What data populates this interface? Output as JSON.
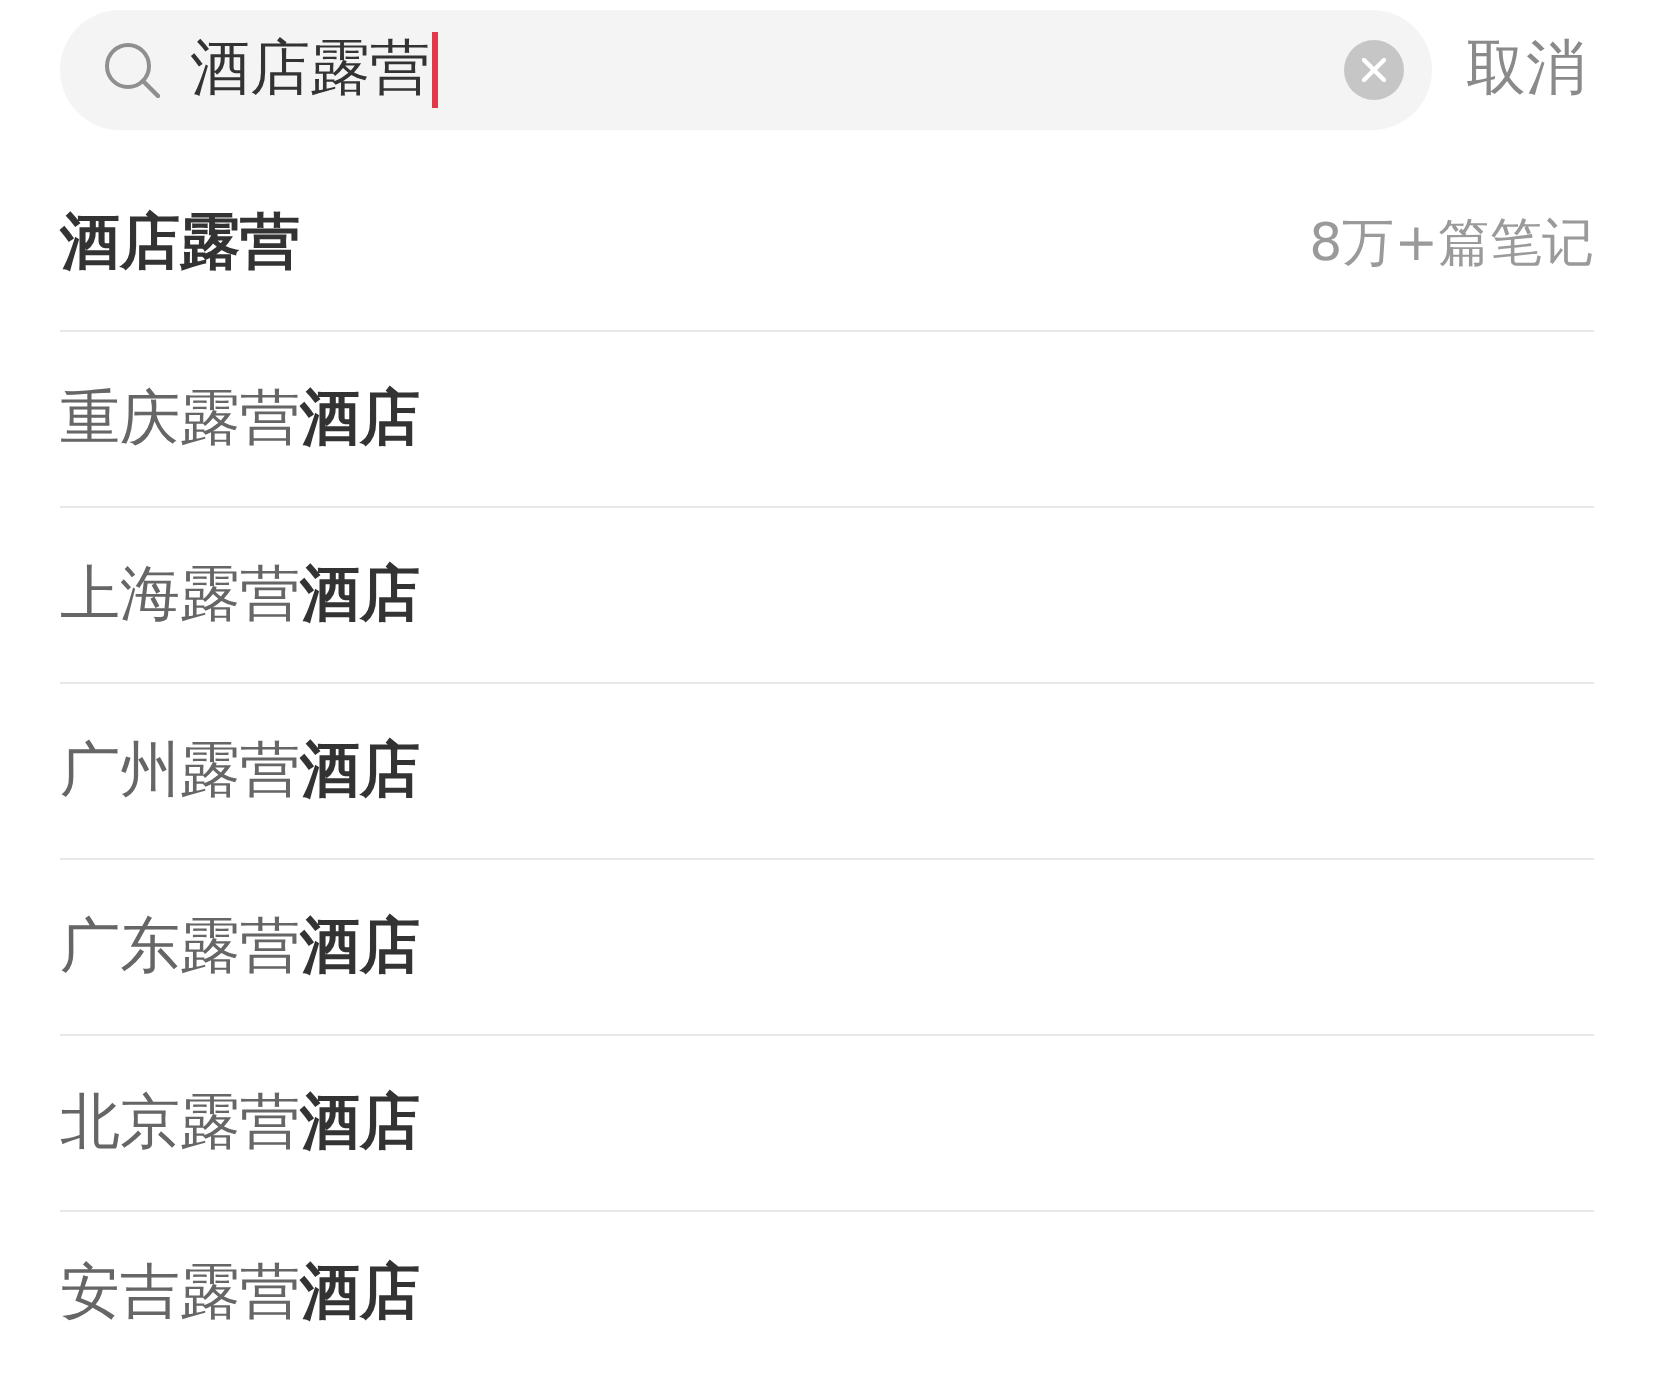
{
  "search": {
    "query": "酒店露营",
    "focused": true,
    "cancel": "取消"
  },
  "suggestions": [
    {
      "kind": "query",
      "text": "酒店露营",
      "note": "8万+篇笔记"
    },
    {
      "kind": "suggestion",
      "text": "重庆露营**酒店**"
    },
    {
      "kind": "suggestion",
      "text": "上海露营**酒店**"
    },
    {
      "kind": "suggestion",
      "text": "广州露营**酒店**"
    },
    {
      "kind": "suggestion",
      "text": "广东露营**酒店**"
    },
    {
      "kind": "suggestion",
      "text": "北京露营**酒店**"
    },
    {
      "kind": "suggestion",
      "text": "安吉露营**酒店**"
    }
  ]
}
